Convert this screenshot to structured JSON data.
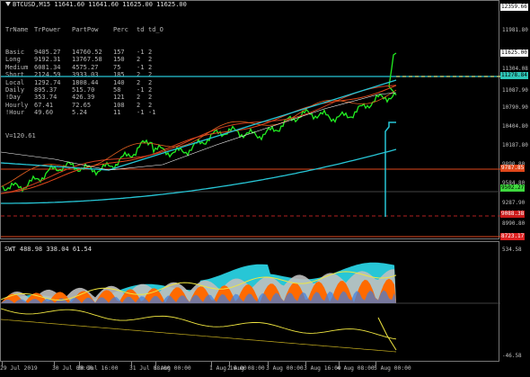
{
  "chart_title": "BTCUSD,M15  11641.60 11641.60 11625.00 11625.00",
  "info_table": {
    "headers": [
      "TrName",
      "TrPower",
      "PartPow",
      "Perc",
      "td",
      "td_O"
    ],
    "rows": [
      [
        "Basic",
        "9405.27",
        "14760.52",
        "157",
        "-1",
        "2"
      ],
      [
        "Long",
        "9192.31",
        "13767.58",
        "150",
        "2",
        "2"
      ],
      [
        "Medium",
        "6081.34",
        "4575.27",
        "75",
        "-1",
        "2"
      ],
      [
        "Short",
        "2124.59",
        "3933.03",
        "185",
        "2",
        "2"
      ],
      [
        "Local",
        "1292.74",
        "1808.44",
        "140",
        "2",
        "2"
      ],
      [
        "Daily",
        "895.37",
        "515.70",
        "58",
        "-1",
        "2"
      ],
      [
        "!Day",
        "353.74",
        "426.39",
        "121",
        "2",
        "2"
      ],
      [
        "Hourly",
        "67.41",
        "72.65",
        "108",
        "2",
        "2"
      ],
      [
        "!Hour",
        "49.60",
        "5.24",
        "11",
        "-1",
        "-1"
      ]
    ],
    "footer": "V=120.61"
  },
  "price_scale": [
    "11981.80",
    "11634.90",
    "11304.08",
    "11087.90",
    "10790.90",
    "10404.80",
    "10187.80",
    "9890.80",
    "9584.80",
    "9287.90",
    "8990.80"
  ],
  "price_tags": [
    {
      "label": "12359.66",
      "bg": "#ffffff",
      "fg": "#000000"
    },
    {
      "label": "11625.00",
      "bg": "#ffffff",
      "fg": "#000000"
    },
    {
      "label": "11278.84",
      "bg": "#2fc7b8",
      "fg": "#000000"
    },
    {
      "label": "9787.85",
      "bg": "#e0471b",
      "fg": "#ffffff"
    },
    {
      "label": "9502.27",
      "bg": "#3ed83e",
      "fg": "#000000"
    },
    {
      "label": "9088.38",
      "bg": "#cc1b1b",
      "fg": "#ffffff"
    },
    {
      "label": "8723.17",
      "bg": "#dd2222",
      "fg": "#ffffff"
    }
  ],
  "osc_title": "SWT 488.98 338.04 61.54",
  "osc_scale": [
    "534.58",
    "-46.58"
  ],
  "x_labels": [
    "29 Jul 2019",
    "30 Jul 00:00",
    "30 Jul 16:00",
    "31 Jul 08:00",
    "1 Aug 00:00",
    "1 Aug 16:00",
    "2 Aug 08:00",
    "3 Aug 00:00",
    "3 Aug 16:00",
    "4 Aug 08:00",
    "5 Aug 00:00"
  ],
  "colors": {
    "price": "#22ee22",
    "cyan": "#27c6d6",
    "red": "#e0471b",
    "yellow": "#f0e640",
    "orange": "#ff6a00",
    "grey": "#bfbfbf",
    "dark_red": "#b02020"
  }
}
